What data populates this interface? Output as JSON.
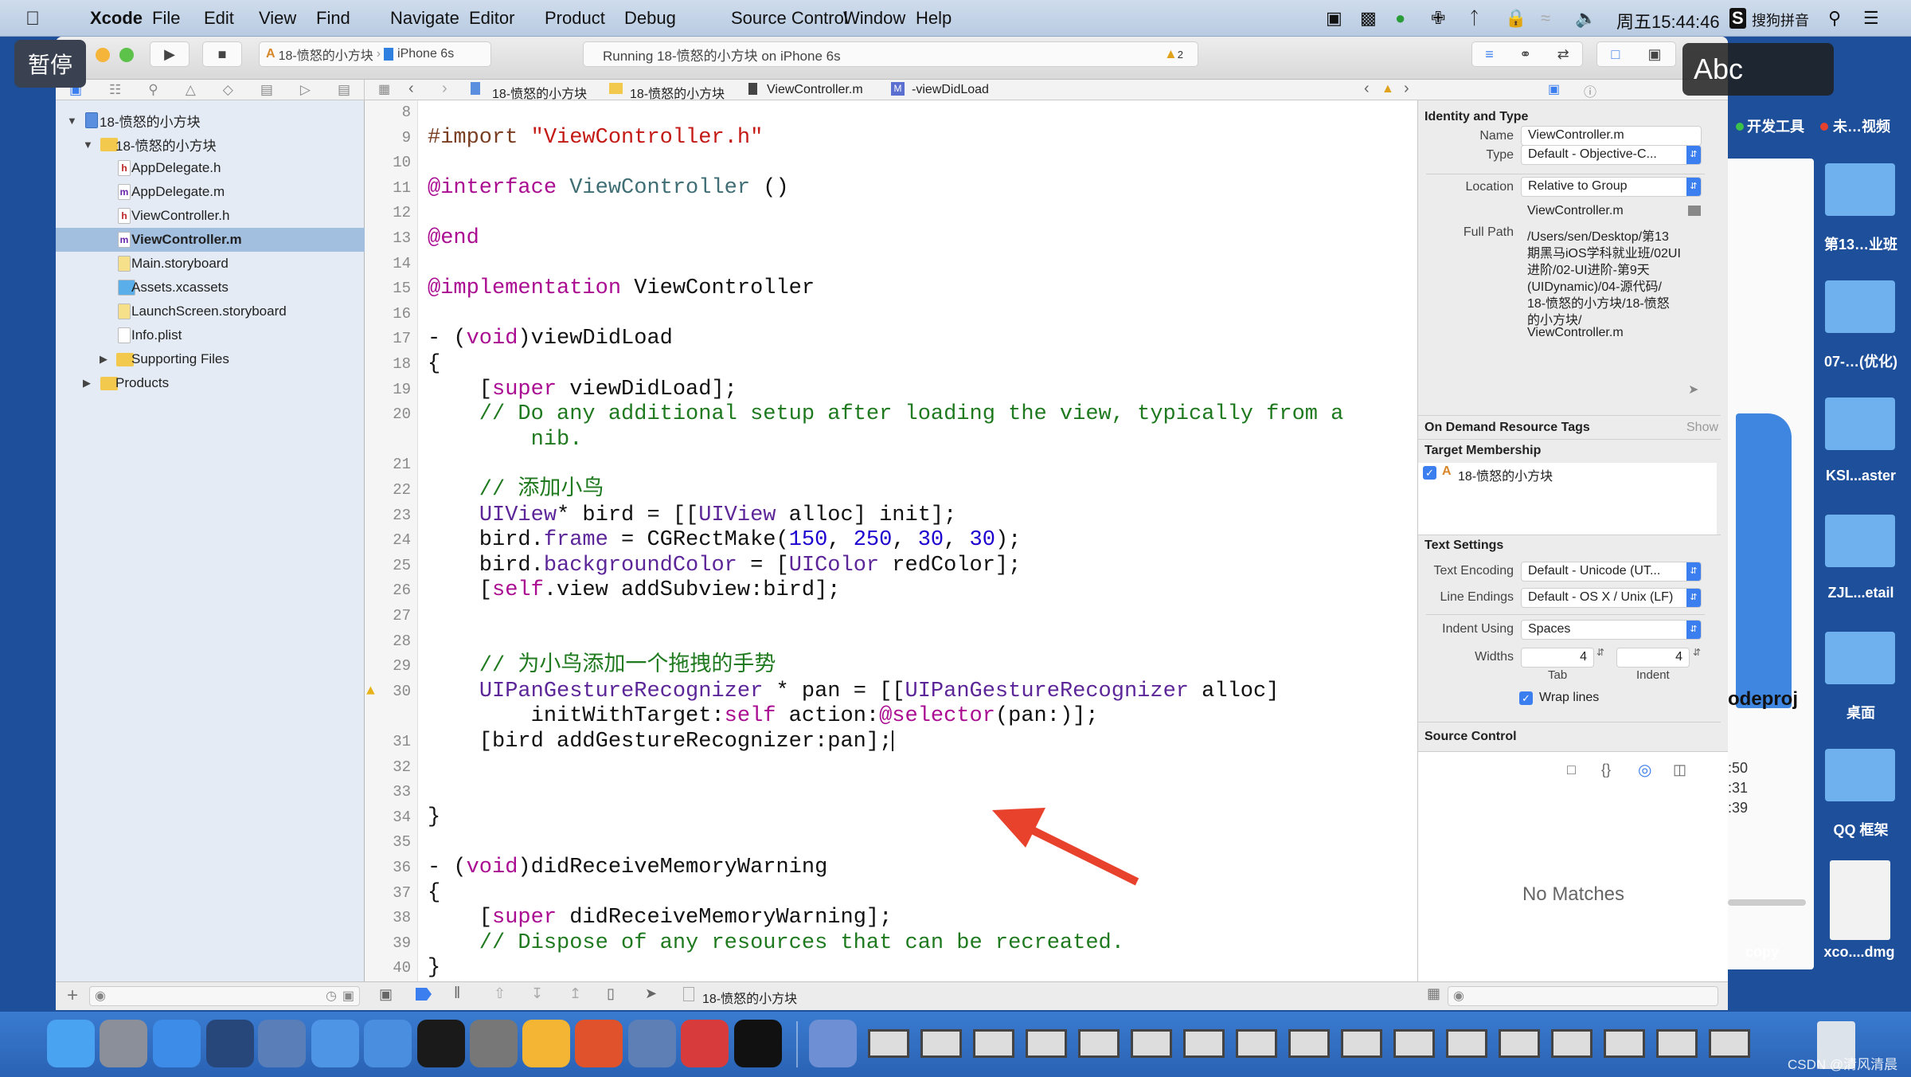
{
  "menubar": {
    "apple_icon": "apple-logo",
    "items": [
      "Xcode",
      "File",
      "Edit",
      "View",
      "Find",
      "Navigate",
      "Editor",
      "Product",
      "Debug",
      "Source Control",
      "Window",
      "Help"
    ],
    "clock": "周五15:44:46",
    "input_method": "搜狗拼音",
    "status_icons": [
      "screen-mirror-icon",
      "video-record-icon",
      "app-status-icon",
      "fan-icon",
      "bluetooth-icon",
      "lock-icon",
      "wifi-icon",
      "volume-icon"
    ]
  },
  "overlays": {
    "pause": "暂停",
    "abc": "Abc"
  },
  "toolbar": {
    "scheme": "18-愤怒的小方块",
    "device": "iPhone 6s",
    "activity": "Running 18-愤怒的小方块 on iPhone 6s",
    "warning_count": "2"
  },
  "jumpbar": {
    "crumbs": [
      "18-愤怒的小方块",
      "18-愤怒的小方块",
      "ViewController.m",
      "-viewDidLoad"
    ]
  },
  "navigator": {
    "items": [
      {
        "label": "18-愤怒的小方块",
        "icon": "project",
        "level": 0,
        "disclosure": "open"
      },
      {
        "label": "18-愤怒的小方块",
        "icon": "folder",
        "level": 1,
        "disclosure": "open"
      },
      {
        "label": "AppDelegate.h",
        "icon": "h",
        "level": 2
      },
      {
        "label": "AppDelegate.m",
        "icon": "m",
        "level": 2
      },
      {
        "label": "ViewController.h",
        "icon": "h",
        "level": 2
      },
      {
        "label": "ViewController.m",
        "icon": "m",
        "level": 2,
        "selected": true
      },
      {
        "label": "Main.storyboard",
        "icon": "storyboard",
        "level": 2
      },
      {
        "label": "Assets.xcassets",
        "icon": "assets",
        "level": 2
      },
      {
        "label": "LaunchScreen.storyboard",
        "icon": "storyboard",
        "level": 2
      },
      {
        "label": "Info.plist",
        "icon": "plist",
        "level": 2
      },
      {
        "label": "Supporting Files",
        "icon": "folder",
        "level": 2,
        "disclosure": "closed"
      },
      {
        "label": "Products",
        "icon": "folder",
        "level": 1,
        "disclosure": "closed"
      }
    ]
  },
  "editor": {
    "warning_line": 30,
    "lines": [
      {
        "n": "8",
        "t": []
      },
      {
        "n": "9",
        "t": [
          [
            "pp",
            "#import "
          ],
          [
            "str",
            "\"ViewController.h\""
          ]
        ]
      },
      {
        "n": "10",
        "t": []
      },
      {
        "n": "11",
        "t": [
          [
            "kw",
            "@interface"
          ],
          [
            "pl",
            " "
          ],
          [
            "cls2",
            "ViewController"
          ],
          [
            "pl",
            " ()"
          ]
        ]
      },
      {
        "n": "12",
        "t": []
      },
      {
        "n": "13",
        "t": [
          [
            "kw",
            "@end"
          ]
        ]
      },
      {
        "n": "14",
        "t": []
      },
      {
        "n": "15",
        "t": [
          [
            "kw",
            "@implementation"
          ],
          [
            "pl",
            " ViewController"
          ]
        ]
      },
      {
        "n": "16",
        "t": []
      },
      {
        "n": "17",
        "t": [
          [
            "pl",
            "- ("
          ],
          [
            "kw",
            "void"
          ],
          [
            "pl",
            ")viewDidLoad"
          ]
        ]
      },
      {
        "n": "18",
        "t": [
          [
            "pl",
            "{"
          ]
        ]
      },
      {
        "n": "19",
        "t": [
          [
            "pl",
            "    ["
          ],
          [
            "kw",
            "super"
          ],
          [
            "pl",
            " viewDidLoad];"
          ]
        ]
      },
      {
        "n": "20",
        "t": [
          [
            "cm",
            "    // Do any additional setup after loading the view, typically from a"
          ]
        ]
      },
      {
        "n": "",
        "t": [
          [
            "cm",
            "        nib."
          ]
        ]
      },
      {
        "n": "21",
        "t": []
      },
      {
        "n": "22",
        "t": [
          [
            "cm",
            "    // 添加小鸟"
          ]
        ]
      },
      {
        "n": "23",
        "t": [
          [
            "pl",
            "    "
          ],
          [
            "cls",
            "UIView"
          ],
          [
            "pl",
            "* bird = [["
          ],
          [
            "cls",
            "UIView"
          ],
          [
            "pl",
            " alloc] init];"
          ]
        ]
      },
      {
        "n": "24",
        "t": [
          [
            "pl",
            "    bird."
          ],
          [
            "cls",
            "frame"
          ],
          [
            "pl",
            " = CGRectMake("
          ],
          [
            "num",
            "150"
          ],
          [
            "pl",
            ", "
          ],
          [
            "num",
            "250"
          ],
          [
            "pl",
            ", "
          ],
          [
            "num",
            "30"
          ],
          [
            "pl",
            ", "
          ],
          [
            "num",
            "30"
          ],
          [
            "pl",
            ");"
          ]
        ]
      },
      {
        "n": "25",
        "t": [
          [
            "pl",
            "    bird."
          ],
          [
            "cls",
            "backgroundColor"
          ],
          [
            "pl",
            " = ["
          ],
          [
            "cls",
            "UIColor"
          ],
          [
            "pl",
            " redColor];"
          ]
        ]
      },
      {
        "n": "26",
        "t": [
          [
            "pl",
            "    ["
          ],
          [
            "kw",
            "self"
          ],
          [
            "pl",
            ".view addSubview:bird];"
          ]
        ]
      },
      {
        "n": "27",
        "t": []
      },
      {
        "n": "28",
        "t": []
      },
      {
        "n": "29",
        "t": [
          [
            "cm",
            "    // 为小鸟添加一个拖拽的手势"
          ]
        ]
      },
      {
        "n": "30",
        "t": [
          [
            "pl",
            "    "
          ],
          [
            "cls",
            "UIPanGestureRecognizer"
          ],
          [
            "pl",
            " * pan = [["
          ],
          [
            "cls",
            "UIPanGestureRecognizer"
          ],
          [
            "pl",
            " alloc]"
          ]
        ]
      },
      {
        "n": "",
        "t": [
          [
            "pl",
            "        initWithTarget:"
          ],
          [
            "kw",
            "self"
          ],
          [
            "pl",
            " action:"
          ],
          [
            "kw",
            "@selector"
          ],
          [
            "pl",
            "(pan:)];"
          ]
        ]
      },
      {
        "n": "31",
        "t": [
          [
            "pl",
            "    [bird addGestureRecognizer:pan];"
          ]
        ],
        "cursor": true
      },
      {
        "n": "32",
        "t": []
      },
      {
        "n": "33",
        "t": []
      },
      {
        "n": "34",
        "t": [
          [
            "pl",
            "}"
          ]
        ]
      },
      {
        "n": "35",
        "t": []
      },
      {
        "n": "36",
        "t": [
          [
            "pl",
            "- ("
          ],
          [
            "kw",
            "void"
          ],
          [
            "pl",
            ")didReceiveMemoryWarning"
          ]
        ]
      },
      {
        "n": "37",
        "t": [
          [
            "pl",
            "{"
          ]
        ]
      },
      {
        "n": "38",
        "t": [
          [
            "pl",
            "    ["
          ],
          [
            "kw",
            "super"
          ],
          [
            "pl",
            " didReceiveMemoryWarning];"
          ]
        ]
      },
      {
        "n": "39",
        "t": [
          [
            "cm",
            "    // Dispose of any resources that can be recreated."
          ]
        ]
      },
      {
        "n": "40",
        "t": [
          [
            "pl",
            "}"
          ]
        ]
      }
    ],
    "annotation_arrow_color": "#e8412c"
  },
  "inspector": {
    "identity": {
      "title": "Identity and Type",
      "name_label": "Name",
      "name_value": "ViewController.m",
      "type_label": "Type",
      "type_value": "Default - Objective-C...",
      "location_label": "Location",
      "location_value": "Relative to Group",
      "location_file": "ViewController.m",
      "fullpath_label": "Full Path",
      "fullpath_lines": [
        "/Users/sen/Desktop/第13",
        "期黑马iOS学科就业班/02UI",
        "进阶/02-UI进阶-第9天",
        "(UIDynamic)/04-源代码/",
        "18-愤怒的小方块/18-愤怒",
        "的小方块/",
        "ViewController.m"
      ]
    },
    "odr": {
      "title": "On Demand Resource Tags",
      "show": "Show"
    },
    "target": {
      "title": "Target Membership",
      "item": "18-愤怒的小方块",
      "checked": true
    },
    "text_settings": {
      "title": "Text Settings",
      "encoding_label": "Text Encoding",
      "encoding_value": "Default - Unicode (UT...",
      "endings_label": "Line Endings",
      "endings_value": "Default - OS X / Unix (LF)",
      "indent_label": "Indent Using",
      "indent_value": "Spaces",
      "widths_label": "Widths",
      "tab_value": "4",
      "indent_width_value": "4",
      "tab_caption": "Tab",
      "indent_caption": "Indent",
      "wrap_label": "Wrap lines",
      "wrap_checked": true
    },
    "source_control": {
      "title": "Source Control"
    },
    "library": {
      "empty": "No Matches"
    }
  },
  "bottombar": {
    "process": "18-愤怒的小方块"
  },
  "desktop": {
    "tags": [
      {
        "label": "开发工具",
        "color": "#3cc14a"
      },
      {
        "label": "未…视频",
        "color": "#e5412f"
      }
    ],
    "folders": [
      "第13…业班",
      "07-…(优化)",
      "KSI...aster",
      "ZJL...etail",
      "桌面",
      "QQ 框架"
    ],
    "dmg": "xco....dmg",
    "copy": "copy",
    "finder_partial": {
      "name": "odeproj",
      "times": [
        ":50",
        ":31",
        ":39"
      ]
    },
    "watermark": "CSDN @清风清晨"
  },
  "dock": {
    "apps": [
      {
        "name": "finder",
        "color": "#4aa3f0"
      },
      {
        "name": "launchpad",
        "color": "#8a8f99"
      },
      {
        "name": "safari",
        "color": "#3d8de8"
      },
      {
        "name": "mouse-app",
        "color": "#27467a"
      },
      {
        "name": "video-app",
        "color": "#5a7fb8"
      },
      {
        "name": "xcode",
        "color": "#4f95e6"
      },
      {
        "name": "simulator",
        "color": "#4a8ee0"
      },
      {
        "name": "terminal",
        "color": "#1a1a1a"
      },
      {
        "name": "system-preferences",
        "color": "#777"
      },
      {
        "name": "sketch",
        "color": "#f3b533"
      },
      {
        "name": "powerpoint-p",
        "color": "#e0522b"
      },
      {
        "name": "quicktime",
        "color": "#5d7fb5"
      },
      {
        "name": "teamviewer",
        "color": "#d83b3b"
      },
      {
        "name": "console",
        "color": "#111"
      },
      {
        "name": "media-player",
        "color": "#6f8fd4"
      }
    ],
    "window_thumbs": 17
  }
}
